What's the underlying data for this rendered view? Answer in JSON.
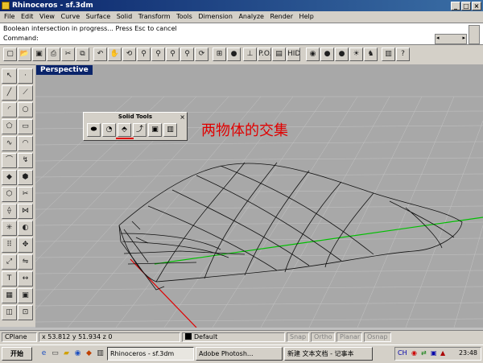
{
  "window": {
    "title": "Rhinoceros - sf.3dm",
    "min": "_",
    "max": "□",
    "close": "×"
  },
  "menu": [
    "File",
    "Edit",
    "View",
    "Curve",
    "Surface",
    "Solid",
    "Transform",
    "Tools",
    "Dimension",
    "Analyze",
    "Render",
    "Help"
  ],
  "command": {
    "history": "Boolean intersection in progress... Press Esc to cancel",
    "prompt": "Command:"
  },
  "toolbar_icons": [
    "new-icon",
    "open-icon",
    "save-icon",
    "print-icon",
    "cut-icon",
    "copy-icon",
    "undo-icon",
    "pan-icon",
    "rotate-icon",
    "zoom-window-icon",
    "zoom-dynamic-icon",
    "zoom-extents-icon",
    "zoom-selected-icon",
    "undo-view-icon",
    "four-views-icon",
    "car-icon",
    "hide-icon",
    "cplane-icon",
    "point-on-icon",
    "hide-label-icon",
    "color-wheel-icon",
    "sphere-icon",
    "render-icon",
    "light-icon",
    "cow-icon",
    "properties-icon",
    "help-icon"
  ],
  "toolbar_labels": {
    "point_on": "P.O.",
    "hide": "HIDE"
  },
  "left_tools": [
    "select-icon",
    "point-icon",
    "line-icon",
    "polyline-icon",
    "arc-icon",
    "circle-icon",
    "polygon-icon",
    "rectangle-icon",
    "curve-icon",
    "freeform-icon",
    "fillet-icon",
    "offset-icon",
    "surface-icon",
    "box-solid-icon",
    "extrude-icon",
    "trim-icon",
    "split-icon",
    "join-icon",
    "explode-icon",
    "boolean-icon",
    "array-icon",
    "move-icon",
    "scale-icon",
    "mirror-icon",
    "text-icon",
    "dimension-icon",
    "layer-icon",
    "group-icon",
    "properties-icon",
    "snap-icon",
    "render-icon",
    "analyze-icon"
  ],
  "viewport": {
    "label": "Perspective"
  },
  "solid_tools": {
    "title": "Solid Tools",
    "close": "×",
    "buttons": [
      "union-icon",
      "difference-icon",
      "intersection-icon",
      "edge-fillet-icon",
      "cap-icon",
      "extrude-surface-icon"
    ]
  },
  "annotation": "两物体的交集",
  "status": {
    "cplane": "CPlane",
    "coords": "x 53.812  y 51.934  z 0",
    "layer": "Default",
    "snap": "Snap",
    "ortho": "Ortho",
    "planar": "Planar",
    "osnap": "Osnap"
  },
  "taskbar": {
    "start": "开始",
    "tasks": [
      "Rhinoceros - sf.3dm",
      "Adobe Photosh...",
      "新建 文本文档 - 记事本"
    ],
    "clock": "23:48"
  }
}
